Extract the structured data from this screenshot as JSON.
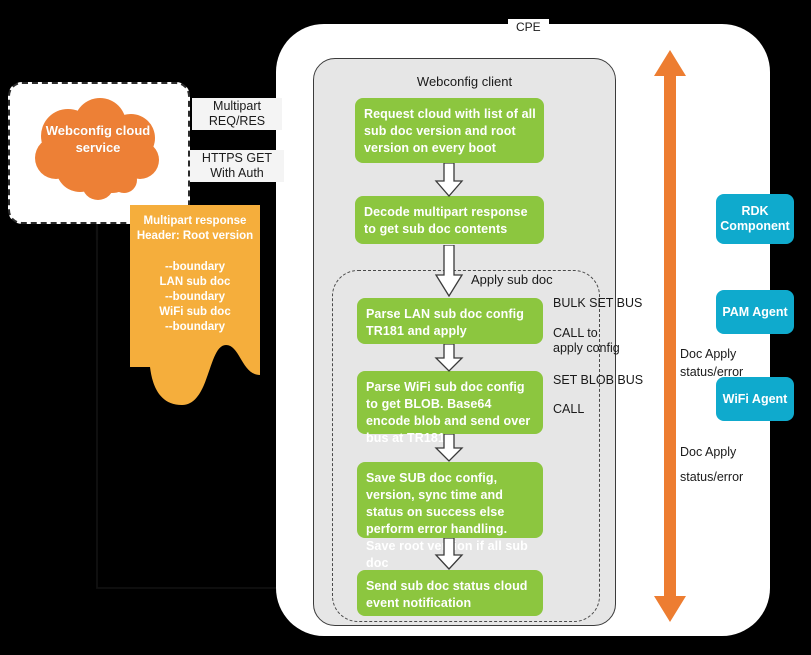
{
  "diagram": {
    "cpe_label": "CPE",
    "webconfig_client_title": "Webconfig client",
    "apply_subdoc_label": "Apply sub doc"
  },
  "cloud": {
    "label": "Webconfig cloud service",
    "color": "#ED8036"
  },
  "edge_labels": {
    "multipart_reqres": "Multipart REQ/RES",
    "https_get": "HTTPS GET With Auth"
  },
  "multipart_doc": {
    "color": "#F5AE3C",
    "header": "Multipart response Header: Root version",
    "body_lines": [
      "--boundary",
      "LAN sub doc",
      "--boundary",
      "WiFi sub doc",
      "--boundary"
    ]
  },
  "steps": [
    {
      "id": "step-1",
      "text": "Request cloud with list of all sub doc version and root version on every boot"
    },
    {
      "id": "step-2",
      "text": "Decode multipart response to get sub doc contents"
    },
    {
      "id": "step-3",
      "text": "Parse LAN sub doc config TR181 and apply"
    },
    {
      "id": "step-4",
      "text": "Parse WiFi sub doc config to get BLOB. Base64 encode blob and send over bus at TR181"
    },
    {
      "id": "step-5",
      "text": "Save SUB doc config, version, sync time and status on success else perform error handling. Save root version if all sub doc"
    },
    {
      "id": "step-6",
      "text": "Send sub doc status cloud event notification"
    }
  ],
  "bus_labels": {
    "bulk_set_bus": "BULK SET BUS",
    "call_to_apply_config": "CALL to apply config",
    "set_blob_bus": "SET BLOB BUS",
    "call": "CALL",
    "doc_apply_1": "Doc Apply",
    "status_error_1": "status/error",
    "doc_apply_2": "Doc Apply",
    "status_error_2": "status/error"
  },
  "agents": [
    {
      "id": "rdk-component",
      "label": "RDK Component"
    },
    {
      "id": "pam-agent",
      "label": "PAM Agent"
    },
    {
      "id": "wifi-agent",
      "label": "WiFi Agent"
    }
  ],
  "colors": {
    "step_green": "#8CC63F",
    "agent_blue": "#0FAACD",
    "bus_orange": "#ED7D31",
    "panel_grey": "#E6E6E6",
    "doc_orange": "#F5AE3C"
  }
}
